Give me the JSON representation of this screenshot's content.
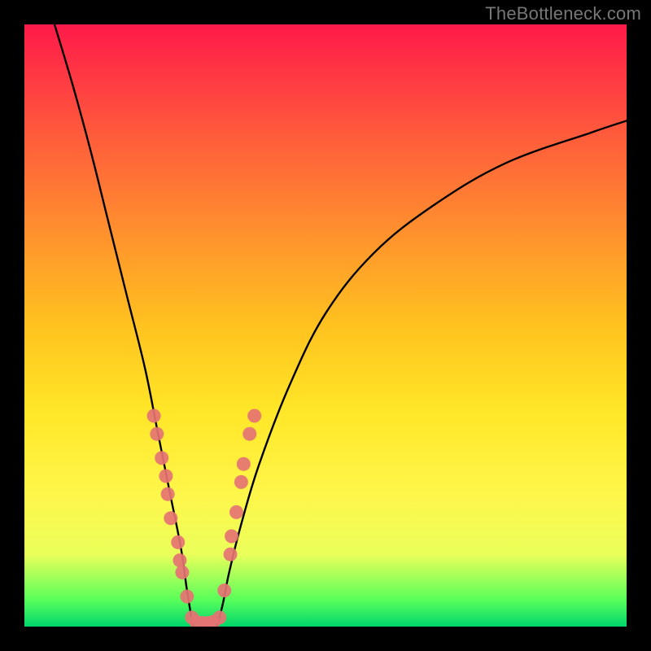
{
  "watermark": "TheBottleneck.com",
  "chart_data": {
    "type": "line",
    "title": "",
    "xlabel": "",
    "ylabel": "",
    "xlim": [
      0,
      100
    ],
    "ylim": [
      0,
      100
    ],
    "grid": false,
    "background_gradient": [
      "#ff1a4a",
      "#ff5a3c",
      "#ff8f2e",
      "#ffc21f",
      "#ffe627",
      "#fff64a",
      "#eaff5a",
      "#5aff5a",
      "#00d66b"
    ],
    "series": [
      {
        "name": "bottleneck-curve-left",
        "x": [
          5,
          8,
          11,
          14,
          17,
          20,
          22,
          24,
          26,
          27,
          28
        ],
        "y": [
          100,
          90,
          79,
          67,
          55,
          43,
          33,
          23,
          13,
          6,
          0
        ]
      },
      {
        "name": "bottleneck-curve-right",
        "x": [
          32,
          33,
          34,
          36,
          39,
          44,
          50,
          58,
          68,
          80,
          94,
          100
        ],
        "y": [
          0,
          4,
          9,
          17,
          27,
          40,
          52,
          62,
          70,
          77,
          82,
          84
        ]
      }
    ],
    "scatter": {
      "name": "sample-points",
      "color": "#e57373",
      "points": [
        {
          "x": 21.5,
          "y": 35
        },
        {
          "x": 22.0,
          "y": 32
        },
        {
          "x": 22.8,
          "y": 28
        },
        {
          "x": 23.5,
          "y": 25
        },
        {
          "x": 23.8,
          "y": 22
        },
        {
          "x": 24.3,
          "y": 18
        },
        {
          "x": 25.5,
          "y": 14
        },
        {
          "x": 25.8,
          "y": 11
        },
        {
          "x": 26.2,
          "y": 9
        },
        {
          "x": 27.0,
          "y": 5
        },
        {
          "x": 27.8,
          "y": 1.5
        },
        {
          "x": 28.5,
          "y": 0.8
        },
        {
          "x": 29.6,
          "y": 0.6
        },
        {
          "x": 30.5,
          "y": 0.6
        },
        {
          "x": 31.4,
          "y": 0.8
        },
        {
          "x": 32.4,
          "y": 1.5
        },
        {
          "x": 33.2,
          "y": 6
        },
        {
          "x": 34.2,
          "y": 12
        },
        {
          "x": 34.4,
          "y": 15
        },
        {
          "x": 35.2,
          "y": 19
        },
        {
          "x": 36.0,
          "y": 24
        },
        {
          "x": 36.4,
          "y": 27
        },
        {
          "x": 37.4,
          "y": 32
        },
        {
          "x": 38.2,
          "y": 35
        }
      ]
    }
  }
}
